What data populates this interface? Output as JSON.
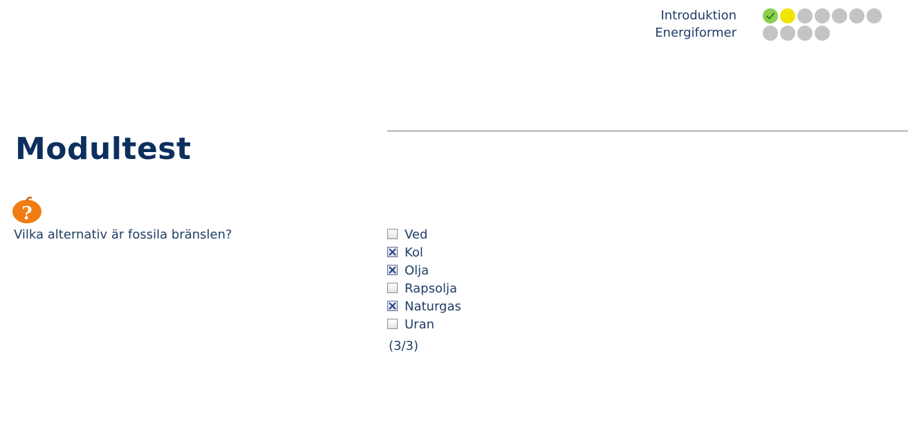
{
  "progress": {
    "rows": [
      {
        "label": "Introduktion",
        "dots": [
          "done",
          "current",
          "todo",
          "todo",
          "todo",
          "todo",
          "todo"
        ]
      },
      {
        "label": "Energiformer",
        "dots": [
          "todo",
          "todo",
          "todo",
          "todo"
        ]
      }
    ],
    "colors": {
      "done": "#8ccf4d",
      "current": "#f1e400",
      "todo": "#c4c4c4"
    }
  },
  "page": {
    "title": "Modultest"
  },
  "question": {
    "icon": "question-mark-icon",
    "text": "Vilka alternativ är fossila bränslen?",
    "options": [
      {
        "label": "Ved",
        "checked": false
      },
      {
        "label": "Kol",
        "checked": true
      },
      {
        "label": "Olja",
        "checked": true
      },
      {
        "label": "Rapsolja",
        "checked": false
      },
      {
        "label": "Naturgas",
        "checked": true
      },
      {
        "label": "Uran",
        "checked": false
      }
    ],
    "score": "(3/3)"
  },
  "colors": {
    "title": "#0d2f5e",
    "text": "#1f3d66",
    "icon": "#f07c12"
  }
}
